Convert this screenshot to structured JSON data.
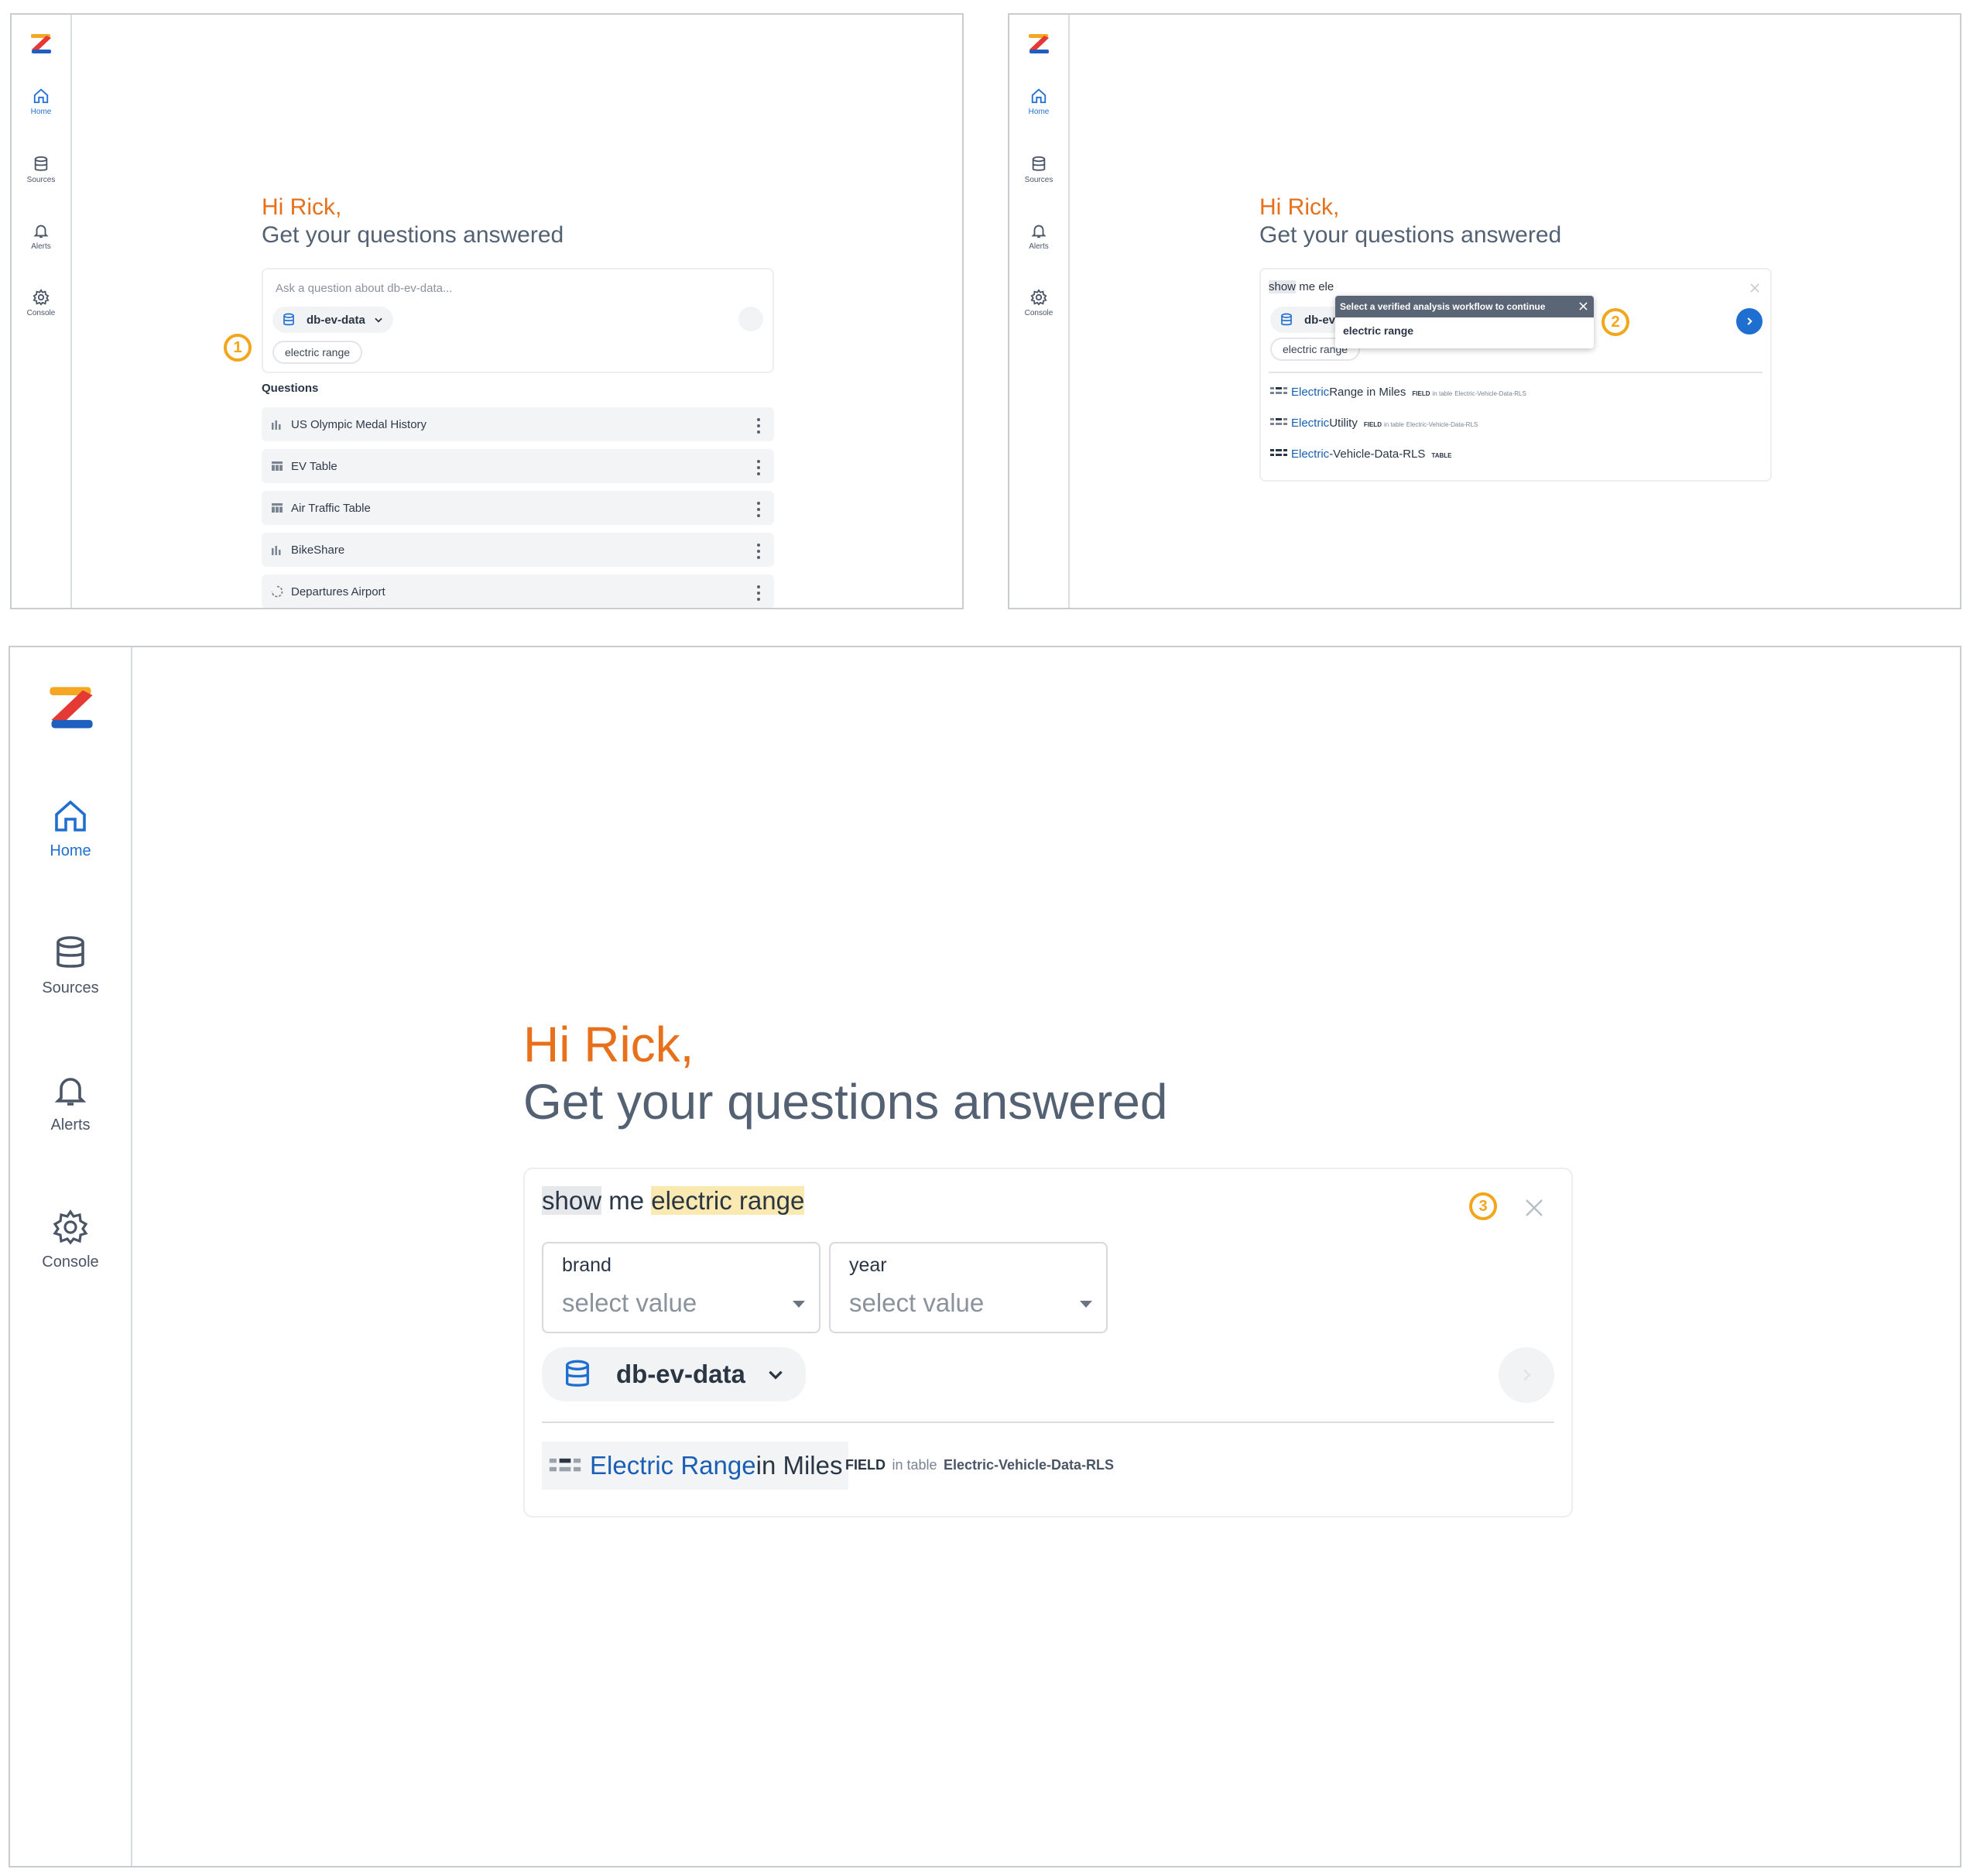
{
  "nav": {
    "home": "Home",
    "sources": "Sources",
    "alerts": "Alerts",
    "console": "Console"
  },
  "greeting": "Hi Rick,",
  "subtitle": "Get your questions answered",
  "panel1": {
    "placeholder": "Ask a question about db-ev-data...",
    "datasource": "db-ev-data",
    "chip": "electric range",
    "marker": "1",
    "questions_heading": "Questions",
    "questions": [
      {
        "label": "US Olympic Medal History",
        "icon": "bar-chart-icon"
      },
      {
        "label": "EV Table",
        "icon": "table-icon"
      },
      {
        "label": "Air Traffic Table",
        "icon": "table-icon"
      },
      {
        "label": "BikeShare",
        "icon": "bar-chart-icon"
      },
      {
        "label": "Departures Airport",
        "icon": "loading-icon"
      }
    ]
  },
  "panel2": {
    "input_text_a": "show",
    "input_text_b": " me ele",
    "datasource_partial": "db-ev",
    "chip": "electric range",
    "tooltip_title": "Select a verified analysis workflow to continue",
    "tooltip_option": "electric range",
    "marker": "2",
    "suggestions": [
      {
        "blue": "Electric",
        "rest": " Range in Miles",
        "kind": "FIELD",
        "in": "in table",
        "table": "Electric-Vehicle-Data-RLS"
      },
      {
        "blue": "Electric",
        "rest": " Utility",
        "kind": "FIELD",
        "in": "in table",
        "table": "Electric-Vehicle-Data-RLS"
      },
      {
        "blue": "Electric",
        "rest": "-Vehicle-Data-RLS",
        "kind": "TABLE",
        "in": "",
        "table": ""
      }
    ]
  },
  "panel3": {
    "input_word1": "show",
    "input_word2": " me ",
    "input_word3": "electric range",
    "marker": "3",
    "filters": [
      {
        "label": "brand",
        "placeholder": "select value"
      },
      {
        "label": "year",
        "placeholder": "select value"
      }
    ],
    "datasource": "db-ev-data",
    "suggestion": {
      "blue": "Electric Range",
      "rest": " in Miles",
      "kind": "FIELD",
      "in": "in table",
      "table": "Electric-Vehicle-Data-RLS"
    }
  },
  "colors": {
    "accent_orange": "#e8701a",
    "marker_yellow": "#f2a61b",
    "brand_blue": "#1f6fd1"
  }
}
